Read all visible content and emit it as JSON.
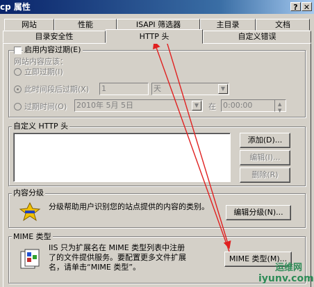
{
  "window": {
    "title": "cp 属性",
    "help_btn": "?",
    "close_btn": "✕"
  },
  "tabs_row1": [
    "网站",
    "性能",
    "ISAPI 筛选器",
    "主目录",
    "文档"
  ],
  "tabs_row2": [
    "目录安全性",
    "HTTP 头",
    "自定义错误"
  ],
  "expiry": {
    "enable_label": "启用内容过期(E)",
    "expire_label": "网站内容应该：",
    "immediate_label": "立即过期(I)",
    "after_label": "此时间段后过期(X)",
    "after_value": "1",
    "after_unit": "天",
    "on_label": "过期时间(O)",
    "date_value": "2010年 5月 5日",
    "at_label": "在",
    "time_value": "0:00:00"
  },
  "custom_headers": {
    "group_label": "自定义 HTTP 头",
    "add_btn": "添加(D)...",
    "edit_btn": "编辑(I)...",
    "delete_btn": "删除(R)"
  },
  "rating": {
    "group_label": "内容分级",
    "description": "分级帮助用户识别您的站点提供的内容的类别。",
    "edit_btn": "编辑分级(N)..."
  },
  "mime": {
    "group_label": "MIME 类型",
    "description_line1": "IIS 只为扩展名在 MIME 类型列表中注册",
    "description_line2": "了的文件提供服务。要配置更多文件扩展",
    "description_line3": "名，请单击“MIME 类型”。",
    "btn": "MIME 类型(M)..."
  },
  "watermark": {
    "cn": "运维网",
    "url": "iyunv.com"
  },
  "colors": {
    "title_start": "#0a246a",
    "title_end": "#a6caf0",
    "face": "#d4d0c8",
    "arrow": "#e02020",
    "rating_icon": "#f0c000"
  }
}
